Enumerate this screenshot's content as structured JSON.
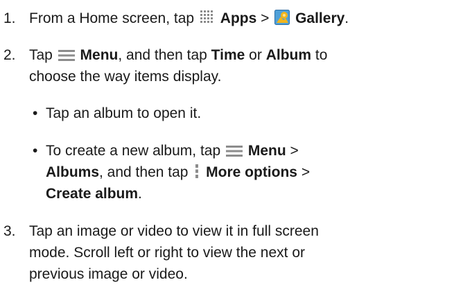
{
  "step1": {
    "number": "1.",
    "t1": "From a Home screen, tap",
    "apps_label": "Apps",
    "t2": ">",
    "gallery_label": "Gallery",
    "t3": "."
  },
  "step2": {
    "number": "2.",
    "t1": "Tap",
    "menu_label": "Menu",
    "t2": ", and then tap",
    "time_label": "Time",
    "t3": "or",
    "album_label": "Album",
    "t4": "to",
    "line2": "choose the way items display.",
    "bullet1": "Tap an album to open it.",
    "bullet2": {
      "t1": "To create a new album, tap",
      "menu_label": "Menu",
      "t2": ">",
      "albums_label": "Albums",
      "t3": ", and then tap",
      "more_options_label": "More options",
      "t4": ">",
      "create_album_label": "Create album",
      "t5": "."
    }
  },
  "step3": {
    "number": "3.",
    "line1": "Tap an image or video to view it in full screen",
    "line2": "mode. Scroll left or right to view the next or",
    "line3": "previous image or video."
  },
  "icons": {
    "apps": "apps-grid-icon",
    "gallery": "gallery-icon",
    "menu": "menu-icon",
    "more_options": "more-options-icon"
  },
  "colors": {
    "text": "#1a1a1a",
    "icon_gray": "#8c8c8c",
    "gallery_bg": "#4fa0d8",
    "gallery_flower": "#f2b51c"
  }
}
